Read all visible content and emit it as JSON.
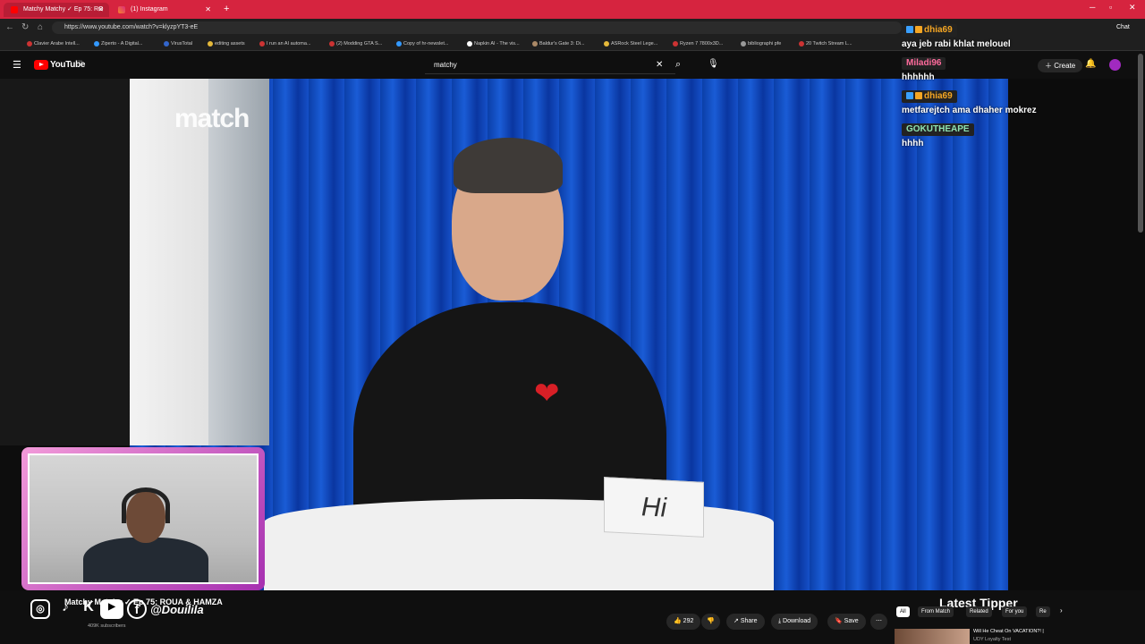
{
  "browser": {
    "tabs": [
      {
        "title": "Matchy Matchy ✓ Ep 75: RO",
        "active": true
      },
      {
        "title": "(1) Instagram",
        "active": false
      }
    ],
    "new_tab": "+",
    "url": "https://www.youtube.com/watch?v=klyzpYT3-eE",
    "bookmarks": [
      "Clavier Arabe Intell...",
      "Ziperto - A Digital...",
      "VirusTotal",
      "editing assets",
      "I run an AI automa...",
      "(2) Modding GTA S...",
      "Copy of hr-newslet...",
      "Napkin AI - The vis...",
      "Baldur's Gate 3: Di...",
      "ASRock Steel Lege...",
      "Ryzen 7 7800x3D...",
      "bibliographi pfe",
      "20 Twitch Stream L..."
    ],
    "chat_label": "Chat"
  },
  "youtube": {
    "logo_text": "YouTube",
    "logo_sup": "TN",
    "search_value": "matchy",
    "create_label": "Create"
  },
  "video": {
    "wall_logo": "match",
    "name_card": "Hi",
    "title": "Matchy Matchy ✓ Ep 75: ROUA & HAMZA",
    "subscribers": "409K subscribers",
    "likes": "292",
    "share": "Share",
    "download": "Download",
    "save": "Save"
  },
  "overlay": {
    "handle": "@Douilila",
    "socials": [
      "instagram-icon",
      "tiktok-icon",
      "kick-icon",
      "youtube-icon",
      "facebook-icon"
    ],
    "latest_tipper_label": "Latest Tipper",
    "chat": [
      {
        "user": "dhia69",
        "color": "#f5a623",
        "text": "aya jeb rabi khlat melouel",
        "badges": true
      },
      {
        "user": "Miladi96",
        "color": "#ff6b9d",
        "text": "hhhhhh",
        "badges": false
      },
      {
        "user": "dhia69",
        "color": "#f5a623",
        "text": "metfarejtch ama dhaher mokrez",
        "badges": true
      },
      {
        "user": "GOKUTHEAPE",
        "color": "#8fe3b0",
        "text": "hhhh",
        "badges": false
      }
    ]
  },
  "sidebar": {
    "chips": [
      "All",
      "From Match",
      "Related",
      "For you",
      "Re"
    ],
    "recommended_title": "Will He Cheat On VACATION?! |",
    "recommended_sub": "UDY Loyalty Test"
  }
}
